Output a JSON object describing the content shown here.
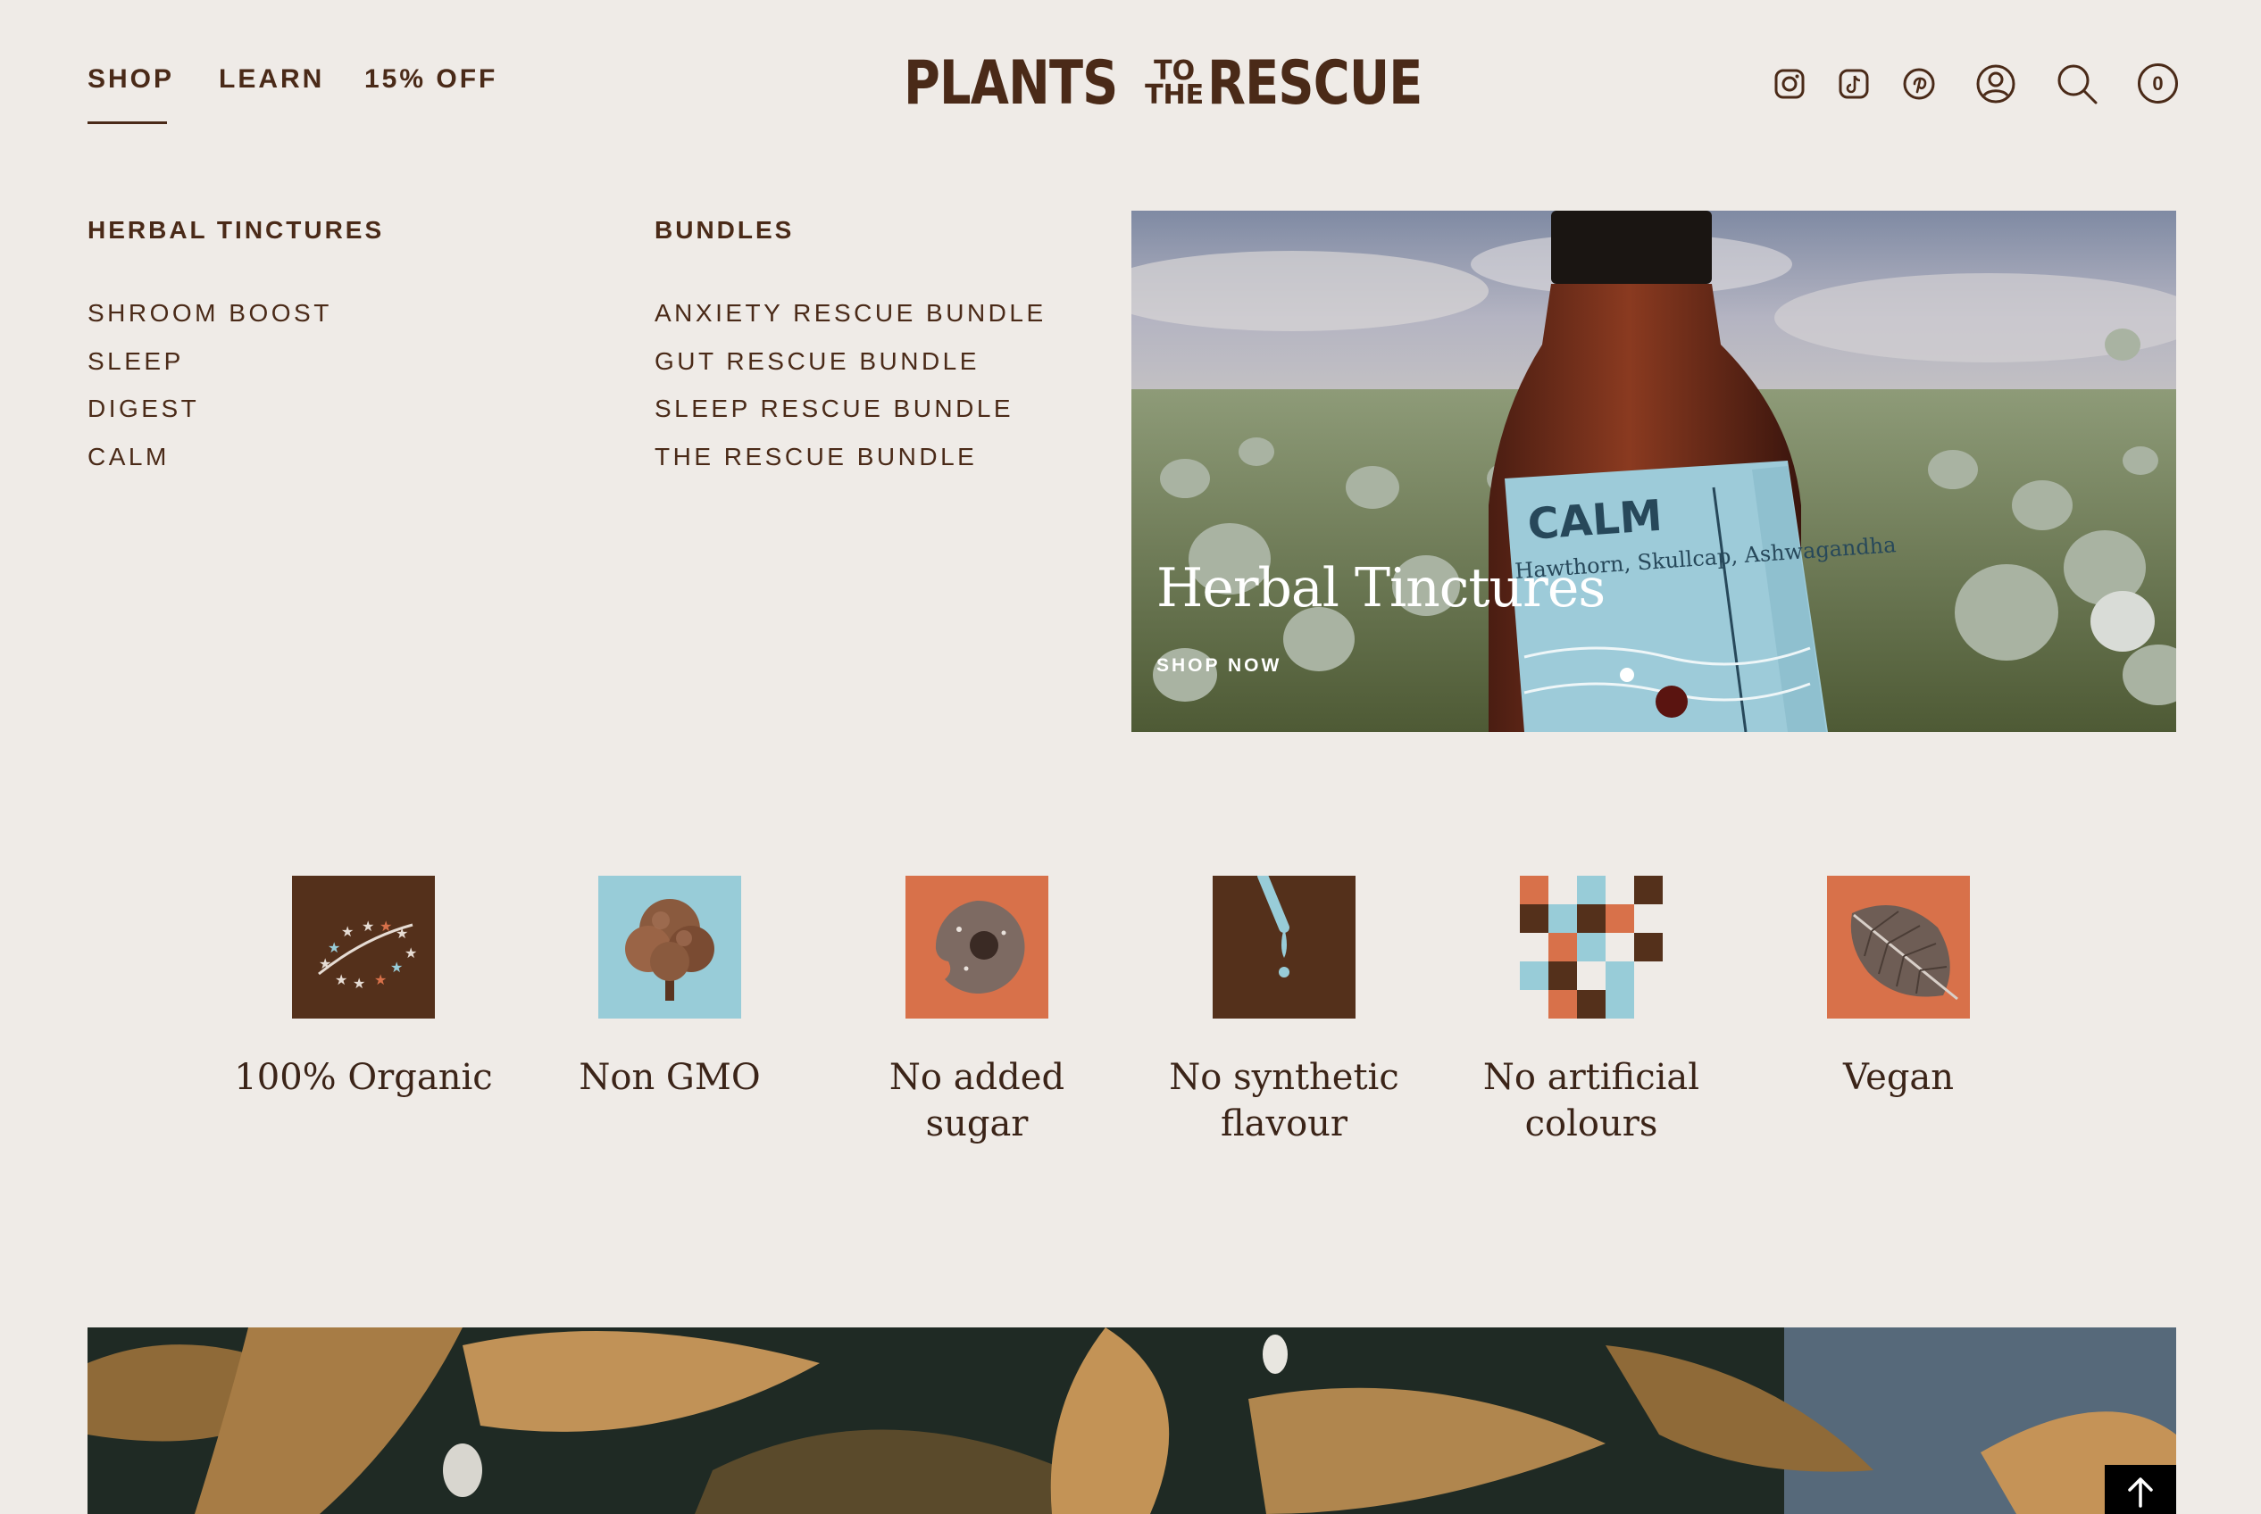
{
  "nav": {
    "shop": "SHOP",
    "learn": "LEARN",
    "offer": "15% OFF"
  },
  "logo": {
    "word1": "PLANTS",
    "to": "TO",
    "the": "THE",
    "word2": "RESCUE"
  },
  "header_icons": [
    "instagram-icon",
    "tiktok-icon",
    "pinterest-icon",
    "account-icon",
    "search-icon",
    "cart-icon"
  ],
  "cart": {
    "count": "0"
  },
  "menu": {
    "col1": {
      "heading": "HERBAL TINCTURES",
      "items": [
        "SHROOM BOOST",
        "SLEEP",
        "DIGEST",
        "CALM"
      ]
    },
    "col2": {
      "heading": "BUNDLES",
      "items": [
        "ANXIETY RESCUE BUNDLE",
        "GUT RESCUE BUNDLE",
        "SLEEP RESCUE BUNDLE",
        "THE RESCUE BUNDLE"
      ]
    }
  },
  "hero": {
    "title": "Herbal Tinctures",
    "cta": "SHOP NOW",
    "bottle_label": "CALM",
    "bottle_sub": "Hawthorn, Skullcap, Ashwagandha"
  },
  "features": [
    {
      "label": "100% Organic",
      "icon": "organic-stars-icon"
    },
    {
      "label": "Non GMO",
      "icon": "tree-icon"
    },
    {
      "label": "No added sugar",
      "icon": "donut-icon"
    },
    {
      "label": "No synthetic flavour",
      "icon": "dropper-icon"
    },
    {
      "label": "No artificial colours",
      "icon": "checker-icon"
    },
    {
      "label": "Vegan",
      "icon": "leaf-icon"
    }
  ],
  "colors": {
    "background": "#efebe7",
    "text": "#4a2a18",
    "brown": "#54301b",
    "blue": "#98ccd8",
    "orange": "#d8714a"
  }
}
